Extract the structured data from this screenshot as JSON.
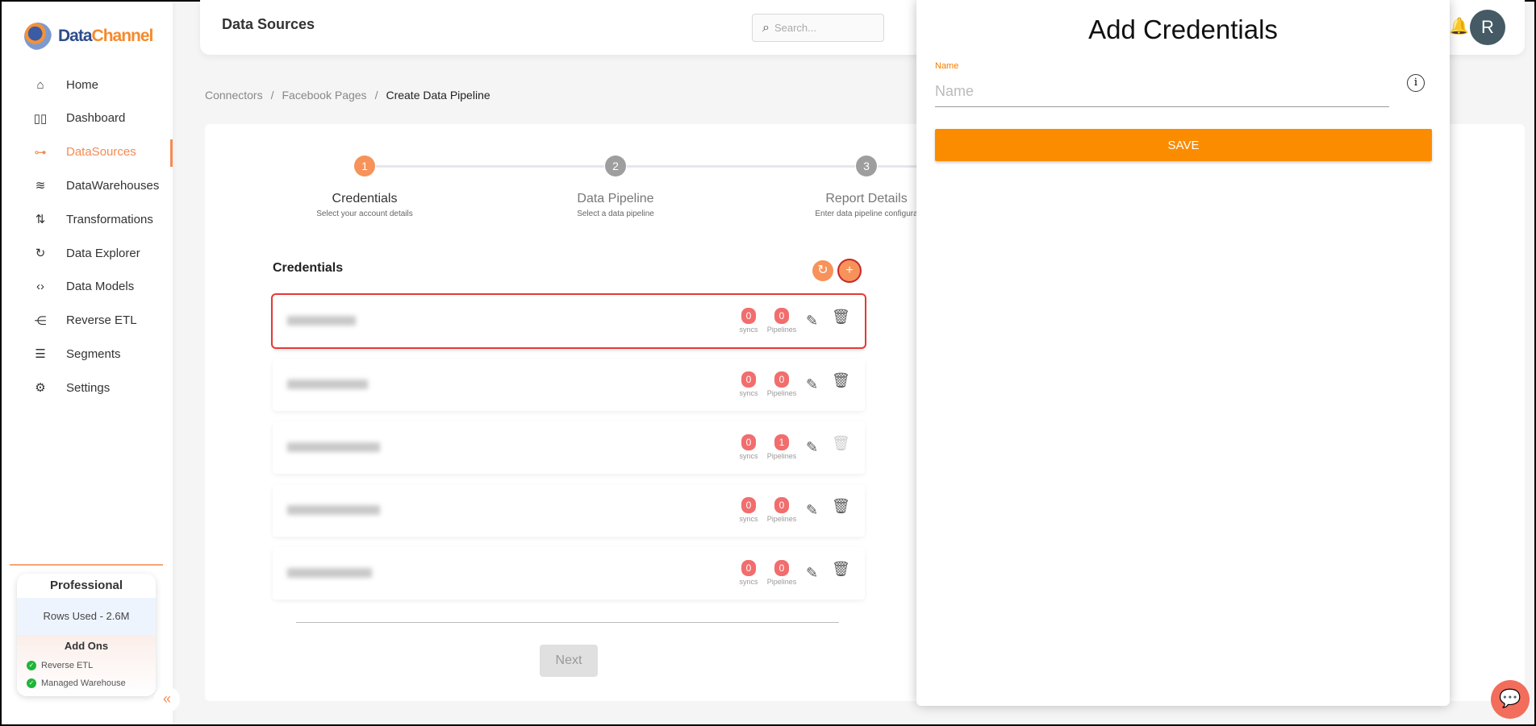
{
  "brand": {
    "name_part1": "Data",
    "name_part2": "Channel"
  },
  "sidebar": {
    "items": [
      {
        "label": "Home",
        "icon": "home-icon"
      },
      {
        "label": "Dashboard",
        "icon": "dashboard-icon"
      },
      {
        "label": "DataSources",
        "icon": "datasources-icon",
        "active": true
      },
      {
        "label": "DataWarehouses",
        "icon": "layers-icon"
      },
      {
        "label": "Transformations",
        "icon": "transform-icon"
      },
      {
        "label": "Data Explorer",
        "icon": "explorer-icon"
      },
      {
        "label": "Data Models",
        "icon": "code-file-icon"
      },
      {
        "label": "Reverse ETL",
        "icon": "tree-icon"
      },
      {
        "label": "Segments",
        "icon": "segments-icon"
      },
      {
        "label": "Settings",
        "icon": "gear-icon"
      }
    ],
    "plan": {
      "title": "Professional",
      "rows_used": "Rows Used - 2.6M",
      "addons_title": "Add Ons",
      "addons": [
        "Reverse ETL",
        "Managed Warehouse"
      ]
    },
    "collapse": "«"
  },
  "header": {
    "title": "Data Sources",
    "search_placeholder": "Search...",
    "avatar": "R"
  },
  "breadcrumb": [
    "Connectors",
    "Facebook Pages",
    "Create Data Pipeline"
  ],
  "stepper": [
    {
      "num": "1",
      "label": "Credentials",
      "sub": "Select your account details",
      "active": true
    },
    {
      "num": "2",
      "label": "Data Pipeline",
      "sub": "Select a data pipeline"
    },
    {
      "num": "3",
      "label": "Report Details",
      "sub": "Enter data pipeline configura"
    }
  ],
  "credentials": {
    "title": "Credentials",
    "syncs_label": "syncs",
    "pipelines_label": "Pipelines",
    "rows": [
      {
        "syncs": "0",
        "pipelines": "0"
      },
      {
        "syncs": "0",
        "pipelines": "0"
      },
      {
        "syncs": "0",
        "pipelines": "1"
      },
      {
        "syncs": "0",
        "pipelines": "0"
      },
      {
        "syncs": "0",
        "pipelines": "0"
      }
    ]
  },
  "next_label": "Next",
  "panel": {
    "title": "Add Credentials",
    "name_label": "Name",
    "name_placeholder": "Name",
    "name_value": "",
    "save_label": "SAVE"
  },
  "colors": {
    "accent": "#f58a53",
    "save": "#fb8c00",
    "badge": "#f26d6d",
    "selection": "#e53935"
  }
}
